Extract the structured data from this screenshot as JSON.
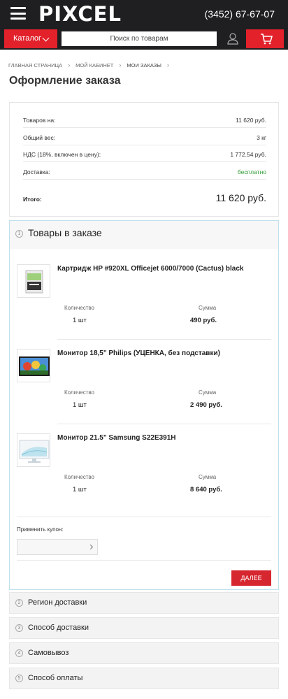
{
  "header": {
    "logo": "PIXCEL",
    "phone": "(3452) 67-67-07"
  },
  "searchbar": {
    "catalog_label": "Каталог",
    "search_placeholder": "Поиск по товарам"
  },
  "breadcrumb": [
    "ГЛАВНАЯ СТРАНИЦА",
    "МОЙ КАБИНЕТ",
    "МОИ ЗАКАЗЫ"
  ],
  "page_title": "Оформление заказа",
  "summary": {
    "rows": [
      {
        "label": "Товаров на:",
        "value": "11 620 руб."
      },
      {
        "label": "Общий вес:",
        "value": "3 кг"
      },
      {
        "label": "НДС (18%, включен в цену):",
        "value": "1 772.54 руб."
      },
      {
        "label": "Доставка:",
        "value": "бесплатно"
      }
    ],
    "total_label": "Итого:",
    "total_value": "11 620 руб."
  },
  "goods": {
    "step": "1",
    "title": "Товары в заказе",
    "qty_label": "Количество",
    "sum_label": "Сумма",
    "items": [
      {
        "name": "Картридж HP #920XL Officejet 6000/7000 (Cactus) black",
        "qty": "1 шт",
        "sum": "490 руб.",
        "image": "cartridge"
      },
      {
        "name": "Монитор 18,5\" Philips (УЦЕНКА, без подставки)",
        "qty": "1 шт",
        "sum": "2 490 руб.",
        "image": "monitor-cartoon"
      },
      {
        "name": "Монитор 21.5\" Samsung S22E391H",
        "qty": "1 шт",
        "sum": "8 640 руб.",
        "image": "monitor-samsung"
      }
    ],
    "coupon_label": "Применить купон:",
    "next_button": "ДАЛЕЕ"
  },
  "sections": [
    {
      "step": "2",
      "title": "Регион доставки"
    },
    {
      "step": "3",
      "title": "Способ доставки"
    },
    {
      "step": "4",
      "title": "Самовывоз"
    },
    {
      "step": "5",
      "title": "Способ оплаты"
    }
  ],
  "colors": {
    "header_bg": "#1f1f21",
    "accent_red": "#e2212b",
    "free_green": "#2f9c34",
    "active_border": "#bfe0ec"
  }
}
